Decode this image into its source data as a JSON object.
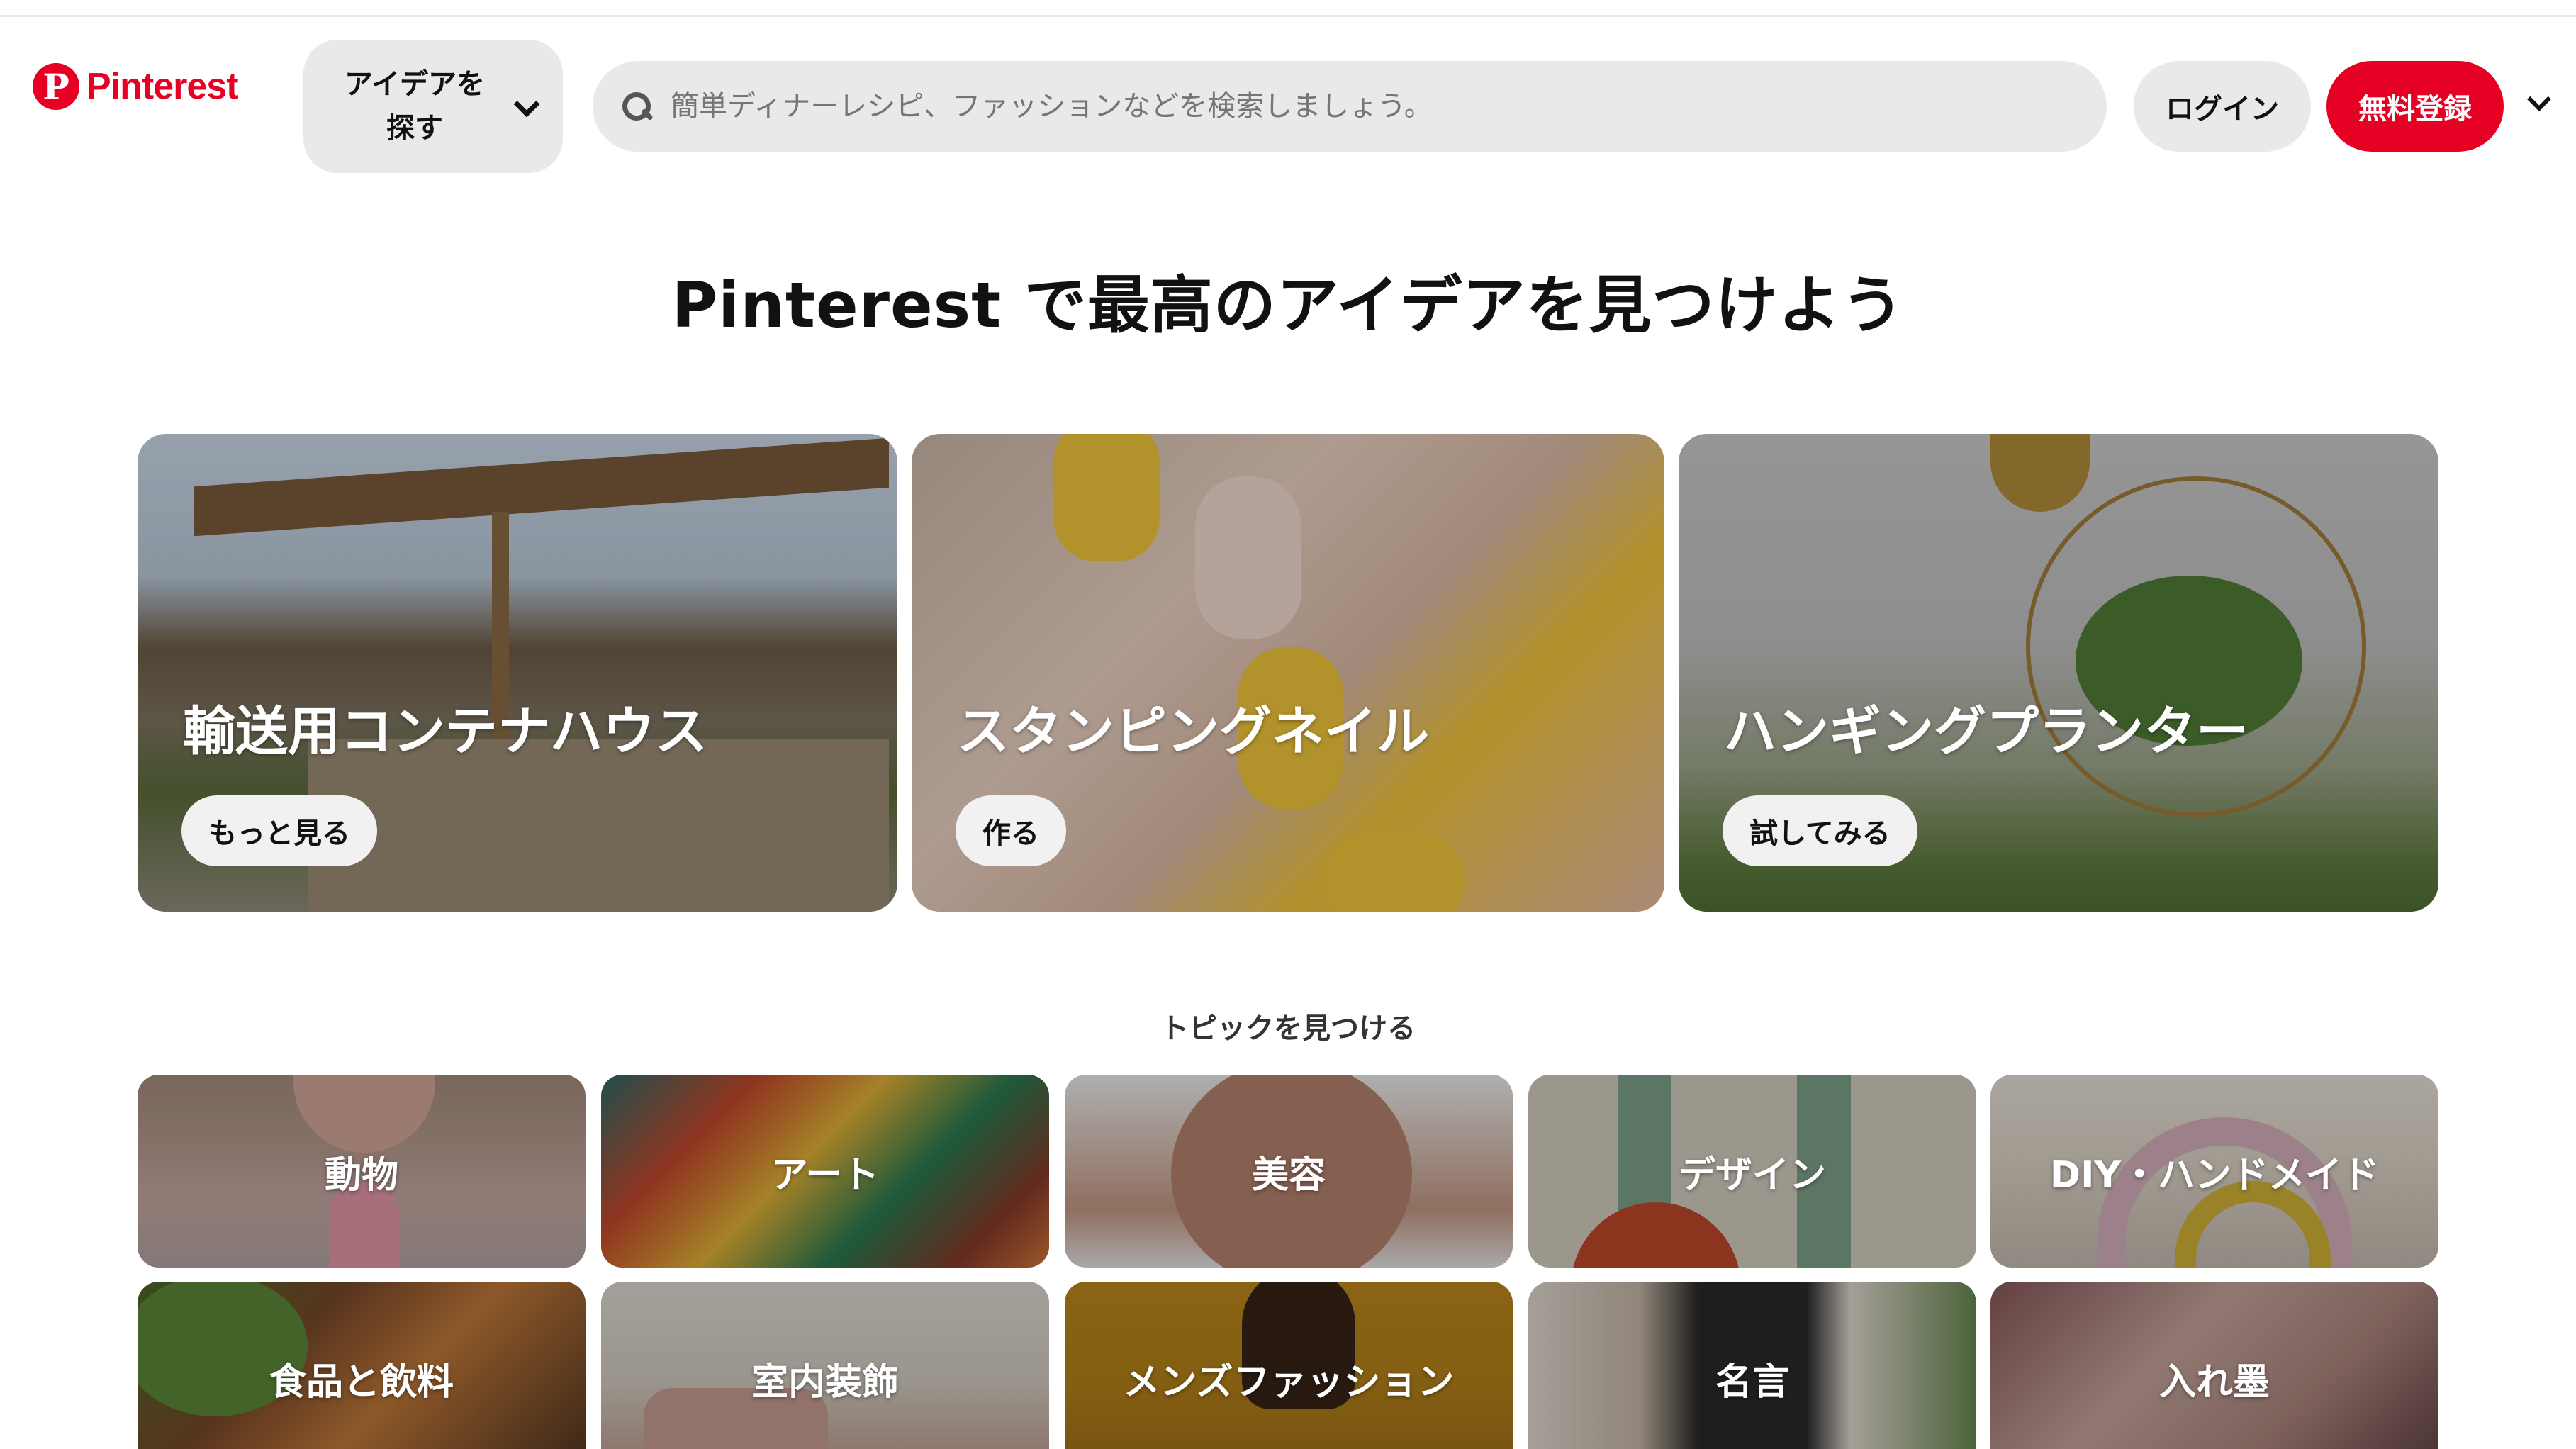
{
  "header": {
    "logo_text": "Pinterest",
    "logo_glyph": "P",
    "explore_label": "アイデアを探す",
    "search_placeholder": "簡単ディナーレシピ、ファッションなどを検索しましょう。",
    "login_label": "ログイン",
    "signup_label": "無料登録",
    "brand_color": "#e60023"
  },
  "main": {
    "title": "Pinterest で最高のアイデアを見つけよう",
    "feature_cards": [
      {
        "title": "輸送用コンテナハウス",
        "button": "もっと見る"
      },
      {
        "title": "スタンピングネイル",
        "button": "作る"
      },
      {
        "title": "ハンギングプランター",
        "button": "試してみる"
      }
    ],
    "topics_title": "トピックを見つける",
    "topics": [
      {
        "label": "動物"
      },
      {
        "label": "アート"
      },
      {
        "label": "美容"
      },
      {
        "label": "デザイン"
      },
      {
        "label": "DIY・ハンドメイド"
      },
      {
        "label": "食品と飲料"
      },
      {
        "label": "室内装飾"
      },
      {
        "label": "メンズファッション"
      },
      {
        "label": "名言"
      },
      {
        "label": "入れ墨"
      }
    ]
  }
}
